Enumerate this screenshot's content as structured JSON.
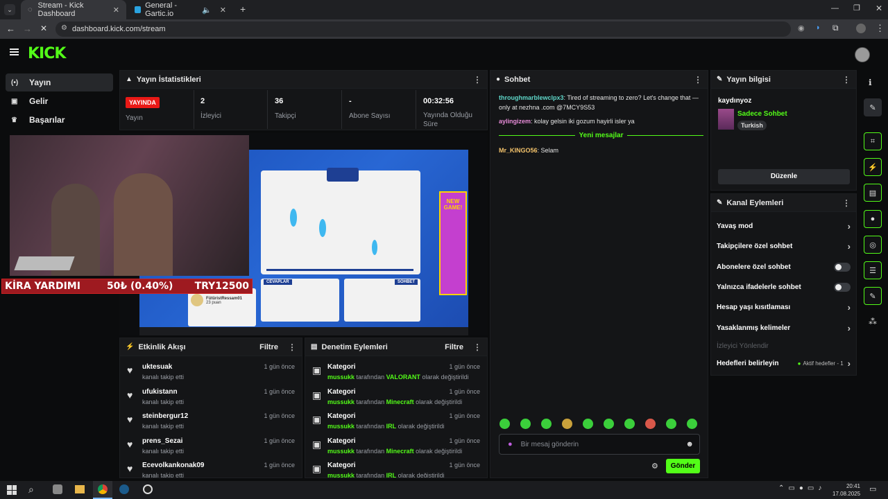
{
  "browser": {
    "tabs": [
      {
        "label": "Stream - Kick Dashboard"
      },
      {
        "label": "General - Gartic.io"
      }
    ],
    "url": "dashboard.kick.com/stream"
  },
  "sidebar": {
    "items": [
      {
        "label": "Yayın",
        "icon": "broadcast-icon"
      },
      {
        "label": "Gelir",
        "icon": "revenue-icon"
      },
      {
        "label": "Başarılar",
        "icon": "trophy-icon"
      }
    ]
  },
  "stats": {
    "title": "Yayın İstatistikleri",
    "live_badge": "YAYINDA",
    "live_label": "Yayın",
    "items": [
      {
        "value": "2",
        "label": "İzleyici"
      },
      {
        "value": "36",
        "label": "Takipçi"
      },
      {
        "value": "-",
        "label": "Abone Sayısı"
      },
      {
        "value": "00:32:56",
        "label": "Yayında Olduğu Süre"
      }
    ]
  },
  "video": {
    "donation_label": "KİRA YARDIMI",
    "donation_amount": "50₺ (0.40%)",
    "donation_goal": "TRY12500",
    "game_answers_label": "CEVAPLAR",
    "game_chat_label": "SOHBET",
    "game_player": "FütüristRessam01",
    "game_points": "23 puan",
    "game_promo": "NEW GAME!"
  },
  "activity": {
    "title": "Etkinlik Akışı",
    "filter": "Filtre",
    "rows": [
      {
        "name": "uktesuak",
        "sub": "kanalı takip etti",
        "time": "1 gün önce"
      },
      {
        "name": "ufukistann",
        "sub": "kanalı takip etti",
        "time": "1 gün önce"
      },
      {
        "name": "steinbergur12",
        "sub": "kanalı takip etti",
        "time": "1 gün önce"
      },
      {
        "name": "prens_Sezai",
        "sub": "kanalı takip etti",
        "time": "1 gün önce"
      },
      {
        "name": "Ecevolkankonak09",
        "sub": "kanalı takip etti",
        "time": "1 gün önce"
      }
    ]
  },
  "moderation": {
    "title": "Denetim Eylemleri",
    "filter": "Filtre",
    "rows": [
      {
        "title": "Kategori",
        "user": "mussukk",
        "mid": "tarafından",
        "cat": "VALORANT",
        "end": "olarak değiştirildi",
        "time": "1 gün önce"
      },
      {
        "title": "Kategori",
        "user": "mussukk",
        "mid": "tarafından",
        "cat": "Minecraft",
        "end": "olarak değiştirildi",
        "time": "1 gün önce"
      },
      {
        "title": "Kategori",
        "user": "mussukk",
        "mid": "tarafından",
        "cat": "IRL",
        "end": "olarak değiştirildi",
        "time": "1 gün önce"
      },
      {
        "title": "Kategori",
        "user": "mussukk",
        "mid": "tarafından",
        "cat": "Minecraft",
        "end": "olarak değiştirildi",
        "time": "1 gün önce"
      },
      {
        "title": "Kategori",
        "user": "mussukk",
        "mid": "tarafından",
        "cat": "IRL",
        "end": "olarak değiştirildi",
        "time": "1 gün önce"
      }
    ]
  },
  "chat": {
    "title": "Sohbet",
    "messages": [
      {
        "user": "throughmarblewclpx3",
        "text": "Tired of streaming to zero? Let's change that — only at nezhna .com @7MCY9S53"
      },
      {
        "user": "aylingizem",
        "text": "kolay gelsin iki gozum hayirli isler ya"
      }
    ],
    "new_divider": "Yeni mesajlar",
    "new_messages": [
      {
        "user": "Mr_KINGO56",
        "text": "Selam"
      }
    ],
    "placeholder": "Bir mesaj gönderin",
    "send": "Gönder"
  },
  "stream_info": {
    "title": "Yayın bilgisi",
    "stream_title": "kaydınyoz",
    "category": "Sadece Sohbet",
    "tag": "Turkish",
    "edit": "Düzenle"
  },
  "channel_actions": {
    "title": "Kanal Eylemleri",
    "items": [
      {
        "label": "Yavaş mod",
        "kind": "chevron"
      },
      {
        "label": "Takipçilere özel sohbet",
        "kind": "chevron"
      },
      {
        "label": "Abonelere özel sohbet",
        "kind": "toggle"
      },
      {
        "label": "Yalnızca ifadelerle sohbet",
        "kind": "toggle"
      },
      {
        "label": "Hesap yaşı kısıtlaması",
        "kind": "chevron"
      },
      {
        "label": "Yasaklanmış kelimeler",
        "kind": "chevron"
      }
    ],
    "disabled_item": "İzleyici Yönlendir",
    "goals_label": "Hedefleri belirleyin",
    "goals_status": "Aktif hedefler - 1"
  },
  "taskbar": {
    "time": "20:41",
    "date": "17.08.2025"
  },
  "colors": {
    "accent": "#53fc18",
    "live": "#e91916"
  }
}
